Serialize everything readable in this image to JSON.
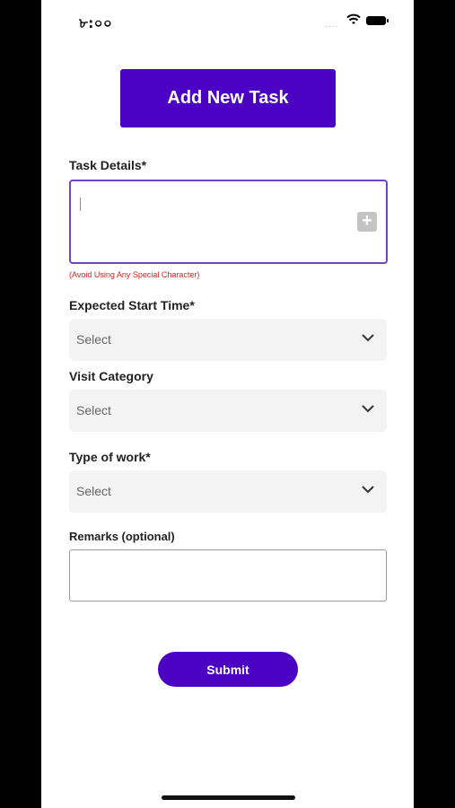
{
  "status_bar": {
    "time": "৮:০০",
    "dots": "....",
    "icons": [
      "wifi-icon",
      "battery-icon"
    ]
  },
  "header": {
    "title": "Add New Task"
  },
  "task_details": {
    "label": "Task  Details*",
    "value": "",
    "hint": "(Avoid Using Any Special Character)",
    "add_icon": "plus-icon"
  },
  "expected_start_time": {
    "label": "Expected Start Time*",
    "value": "Select"
  },
  "visit_category": {
    "label": "Visit Category",
    "value": "Select"
  },
  "type_of_work": {
    "label": "Type of work*",
    "value": "Select"
  },
  "remarks": {
    "label": "Remarks (optional)",
    "value": ""
  },
  "submit": {
    "label": "Submit"
  },
  "colors": {
    "primary": "#4b02c2",
    "field_bg": "#f3f3f3",
    "error": "#e02020",
    "focus_border": "#6d45c5"
  }
}
